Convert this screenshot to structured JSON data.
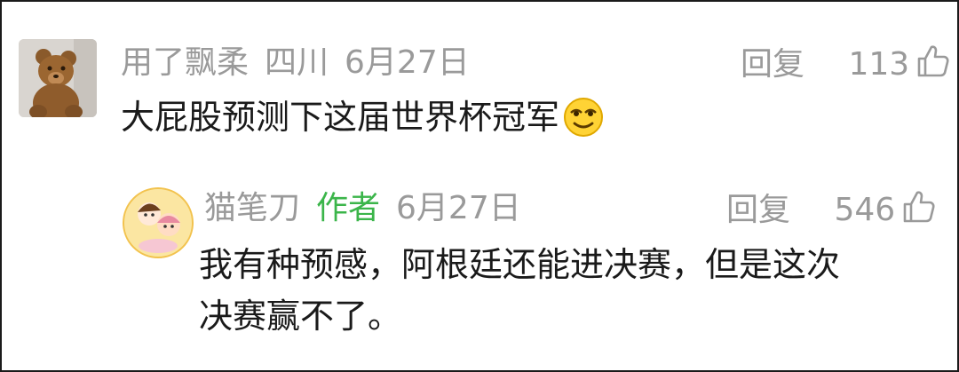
{
  "comment": {
    "username": "用了飘柔",
    "location": "四川",
    "date": "6月27日",
    "reply_label": "回复",
    "likes": "113",
    "text": "大屁股预测下这届世界杯冠军",
    "emoji": "smirk-emoji"
  },
  "reply": {
    "username": "猫笔刀",
    "badge": "作者",
    "date": "6月27日",
    "reply_label": "回复",
    "likes": "546",
    "text_line1": "我有种预感，阿根廷还能进决赛，但是这次",
    "text_line2": "决赛赢不了。"
  },
  "colors": {
    "meta": "#9a9a9a",
    "text": "#1a1a1a",
    "author_badge": "#3bb54a"
  },
  "icons": [
    "thumbs-up-icon",
    "teddy-bear-avatar",
    "cartoon-avatar",
    "smirk-emoji"
  ]
}
